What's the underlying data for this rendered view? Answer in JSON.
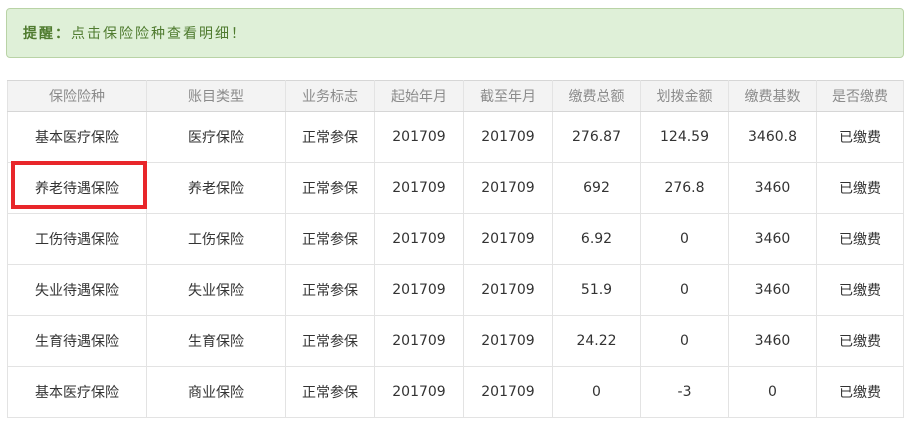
{
  "notice": {
    "label": "提醒：",
    "text": "点击保险险种查看明细！"
  },
  "table": {
    "headers": [
      "保险险种",
      "账目类型",
      "业务标志",
      "起始年月",
      "截至年月",
      "缴费总额",
      "划拨金额",
      "缴费基数",
      "是否缴费"
    ],
    "rows": [
      [
        "基本医疗保险",
        "医疗保险",
        "正常参保",
        "201709",
        "201709",
        "276.87",
        "124.59",
        "3460.8",
        "已缴费"
      ],
      [
        "养老待遇保险",
        "养老保险",
        "正常参保",
        "201709",
        "201709",
        "692",
        "276.8",
        "3460",
        "已缴费"
      ],
      [
        "工伤待遇保险",
        "工伤保险",
        "正常参保",
        "201709",
        "201709",
        "6.92",
        "0",
        "3460",
        "已缴费"
      ],
      [
        "失业待遇保险",
        "失业保险",
        "正常参保",
        "201709",
        "201709",
        "51.9",
        "0",
        "3460",
        "已缴费"
      ],
      [
        "生育待遇保险",
        "生育保险",
        "正常参保",
        "201709",
        "201709",
        "24.22",
        "0",
        "3460",
        "已缴费"
      ],
      [
        "基本医疗保险",
        "商业保险",
        "正常参保",
        "201709",
        "201709",
        "0",
        "-3",
        "0",
        "已缴费"
      ]
    ]
  },
  "colors": {
    "highlight": "#e8262a",
    "alert_bg": "#dff0d8",
    "alert_text": "#4f7b2f"
  }
}
